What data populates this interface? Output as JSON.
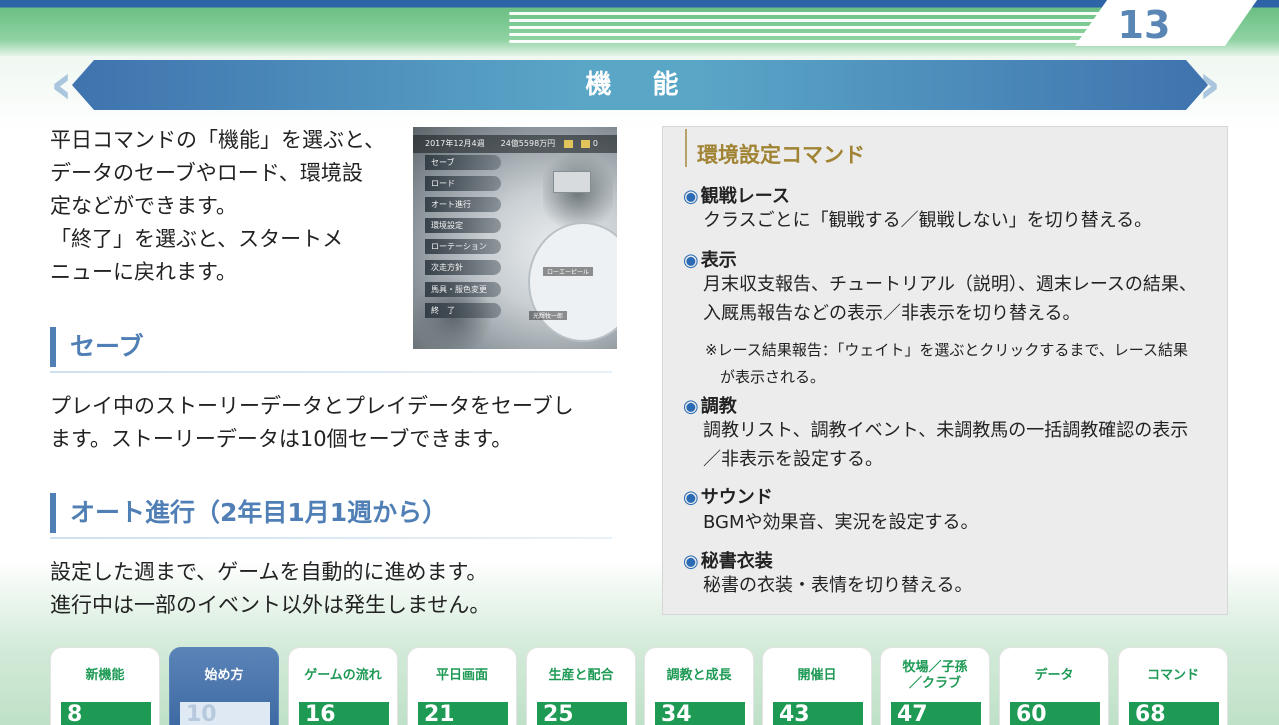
{
  "page": {
    "number": "13",
    "title": "機 能"
  },
  "intro": [
    "平日コマンドの「機能」を選ぶと、",
    "データのセーブやロード、環境設",
    "定などができます。",
    "「終了」を選ぶと、スタートメ",
    "ニューに戻れます。"
  ],
  "screenshot": {
    "hud": "2017年12月4週　　24億5598万円",
    "hud_count": "0",
    "menu": [
      "セーブ",
      "ロード",
      "オート進行",
      "環境設定",
      "ローテーション",
      "次走方針",
      "馬具・服色変更",
      "終　了"
    ],
    "tag1": "ローエーピール",
    "tag2": "光輝牧一郎"
  },
  "sections": [
    {
      "heading": "セーブ",
      "body": [
        "プレイ中のストーリーデータとプレイデータをセーブし",
        "ます。ストーリーデータは10個セーブできます。"
      ]
    },
    {
      "heading": "オート進行（2年目1月1週から）",
      "body": [
        "設定した週まで、ゲームを自動的に進めます。",
        "進行中は一部のイベント以外は発生しません。"
      ]
    }
  ],
  "panel": {
    "title": "環境設定コマンド",
    "bullet": "◉",
    "items": [
      {
        "heading": "観戦レース",
        "body": [
          "クラスごとに「観戦する／観戦しない」を切り替える。"
        ]
      },
      {
        "heading": "表示",
        "body": [
          "月末収支報告、チュートリアル（説明）、週末レースの結果、",
          "入厩馬報告などの表示／非表示を切り替える。"
        ],
        "note": [
          "※レース結果報告：「ウェイト」を選ぶとクリックするまで、レース結果",
          "　が表示される。"
        ]
      },
      {
        "heading": "調教",
        "body": [
          "調教リスト、調教イベント、未調教馬の一括調教確認の表示",
          "／非表示を設定する。"
        ]
      },
      {
        "heading": "サウンド",
        "body": [
          "BGMや効果音、実況を設定する。"
        ]
      },
      {
        "heading": "秘書衣装",
        "body": [
          "秘書の衣装・表情を切り替える。"
        ]
      }
    ]
  },
  "nav": [
    {
      "label": "新機能",
      "page": "8"
    },
    {
      "label": "始め方",
      "page": "10",
      "active": true
    },
    {
      "label": "ゲームの流れ",
      "page": "16"
    },
    {
      "label": "平日画面",
      "page": "21"
    },
    {
      "label": "生産と配合",
      "page": "25"
    },
    {
      "label": "調教と成長",
      "page": "34"
    },
    {
      "label": "開催日",
      "page": "43"
    },
    {
      "label": "牧場／子孫／クラブ",
      "page": "47"
    },
    {
      "label": "データ",
      "page": "60"
    },
    {
      "label": "コマンド",
      "page": "68"
    }
  ],
  "colors": {
    "accent_blue": "#4f7fb5",
    "nav_green": "#1e9a55",
    "panel_title_gold": "#a08333"
  }
}
